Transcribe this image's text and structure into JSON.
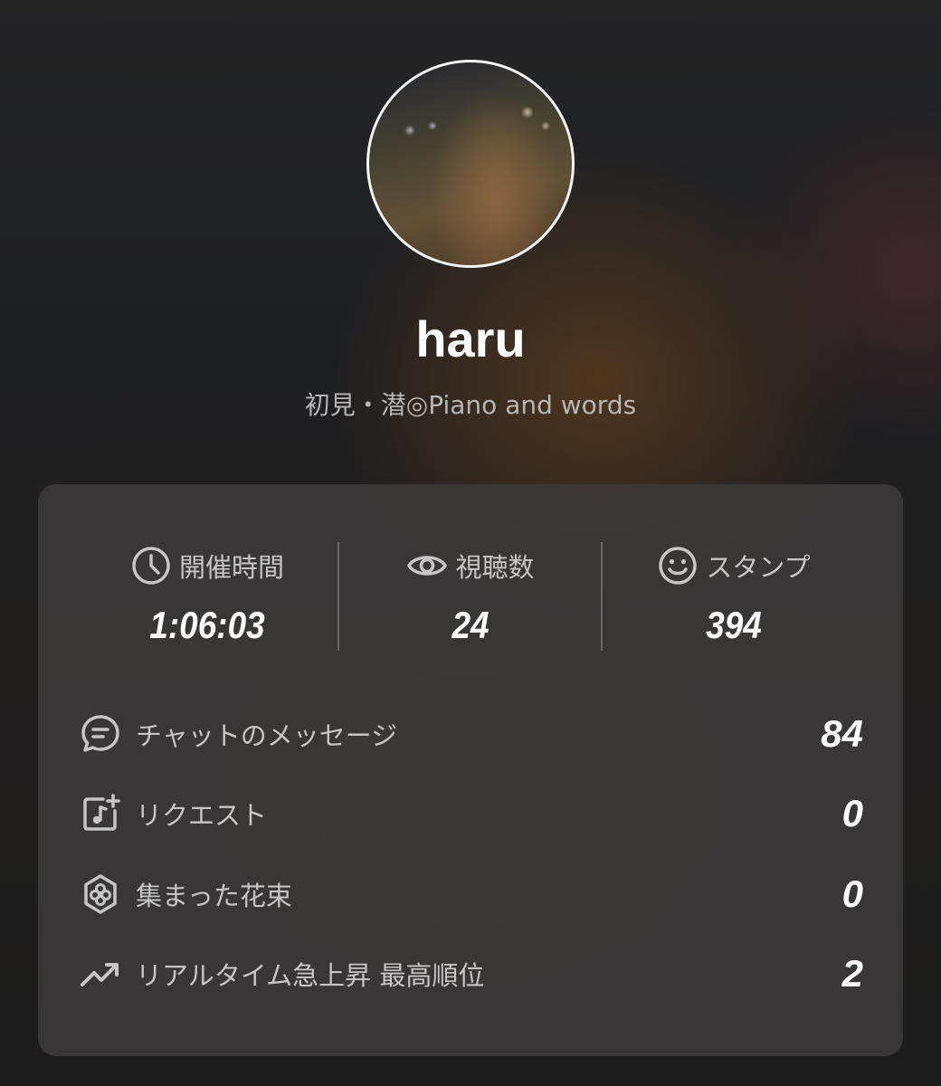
{
  "profile": {
    "name": "haru",
    "subtitle": "初見・潜◎Piano and words",
    "avatar_icon": "profile-photo"
  },
  "stats": [
    {
      "icon": "clock-icon",
      "label": "開催時間",
      "value": "1:06:03"
    },
    {
      "icon": "eye-icon",
      "label": "視聴数",
      "value": "24"
    },
    {
      "icon": "smiley-icon",
      "label": "スタンプ",
      "value": "394"
    }
  ],
  "details": [
    {
      "icon": "chat-bubble-icon",
      "label": "チャットのメッセージ",
      "value": "84"
    },
    {
      "icon": "music-request-icon",
      "label": "リクエスト",
      "value": "0"
    },
    {
      "icon": "flower-icon",
      "label": "集まった花束",
      "value": "0"
    },
    {
      "icon": "trending-up-icon",
      "label": "リアルタイム急上昇 最高順位",
      "value": "2"
    }
  ],
  "colors": {
    "label": "#c6c6c6",
    "value": "#ffffff",
    "card": "#3e3c3c"
  }
}
